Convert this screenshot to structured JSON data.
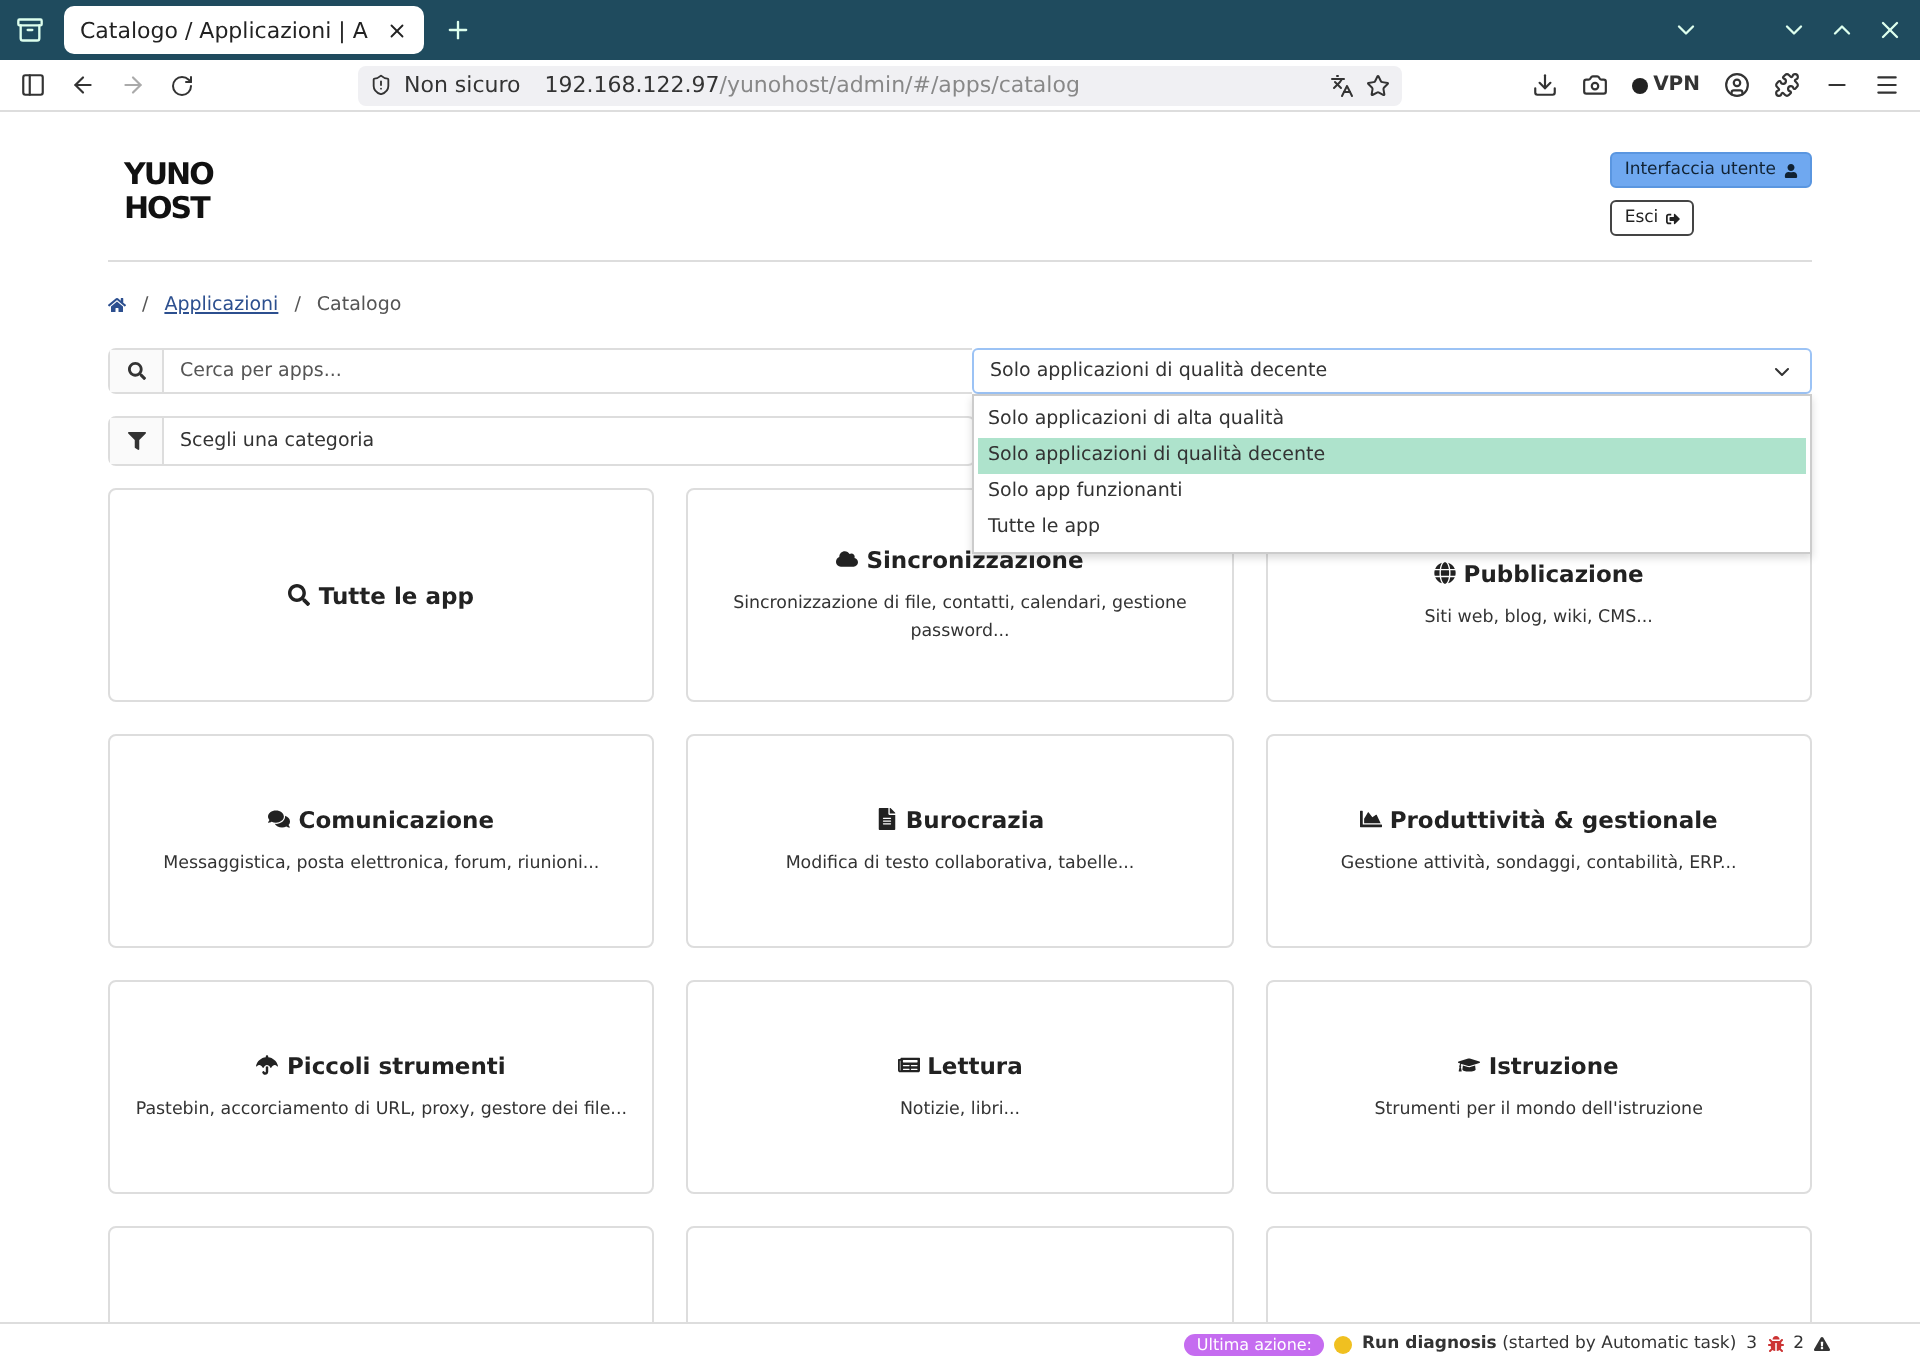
{
  "browser": {
    "tab_title": "Catalogo / Applicazioni | A",
    "security": "Non sicuro",
    "url_host": "192.168.122.97",
    "url_path": "/yunohost/admin/#/apps/catalog",
    "vpn": "VPN"
  },
  "header": {
    "logo_lines": [
      "YUNO",
      "HOST"
    ],
    "user_button": "Interfaccia utente",
    "logout_button": "Esci"
  },
  "breadcrumb": {
    "separator": "/",
    "items": [
      {
        "label": "Applicazioni",
        "kind": "link"
      },
      {
        "label": "Catalogo",
        "kind": "current"
      }
    ]
  },
  "search": {
    "placeholder": "Cerca per apps..."
  },
  "quality_select": {
    "value": "Solo applicazioni di qualità decente",
    "expanded": true,
    "options": [
      {
        "label": "Solo applicazioni di alta qualità",
        "selected": false
      },
      {
        "label": "Solo applicazioni di qualità decente",
        "selected": true
      },
      {
        "label": "Solo app funzionanti",
        "selected": false
      },
      {
        "label": "Tutte le app",
        "selected": false
      }
    ]
  },
  "category_select": {
    "value": "Scegli una categoria"
  },
  "cards": [
    {
      "kind": "category",
      "title": "Tutte le app"
    },
    {
      "kind": "category",
      "title": "Sincronizzazione",
      "description": "Sincronizzazione di file, contatti, calendari, gestione password..."
    },
    {
      "kind": "category",
      "title": "Pubblicazione",
      "description": "Siti web, blog, wiki, CMS..."
    },
    {
      "kind": "category",
      "title": "Comunicazione",
      "description": "Messaggistica, posta elettronica, forum, riunioni..."
    },
    {
      "kind": "category",
      "title": "Burocrazia",
      "description": "Modifica di testo collaborativa, tabelle..."
    },
    {
      "kind": "category",
      "title": "Produttività & gestionale",
      "description": "Gestione attività, sondaggi, contabilità, ERP..."
    },
    {
      "kind": "category",
      "title": "Piccoli strumenti",
      "description": "Pastebin, accorciamento di URL, proxy, gestore dei file..."
    },
    {
      "kind": "category",
      "title": "Lettura",
      "description": "Notizie, libri..."
    },
    {
      "kind": "category",
      "title": "Istruzione",
      "description": "Strumenti per il mondo dell'istruzione"
    },
    {
      "kind": "cut"
    },
    {
      "kind": "cut"
    },
    {
      "kind": "cut"
    }
  ],
  "footer": {
    "badge": "Ultima azione:",
    "action": "Run diagnosis",
    "detail": "(started by Automatic task)",
    "errors": "3",
    "warnings": "2"
  }
}
